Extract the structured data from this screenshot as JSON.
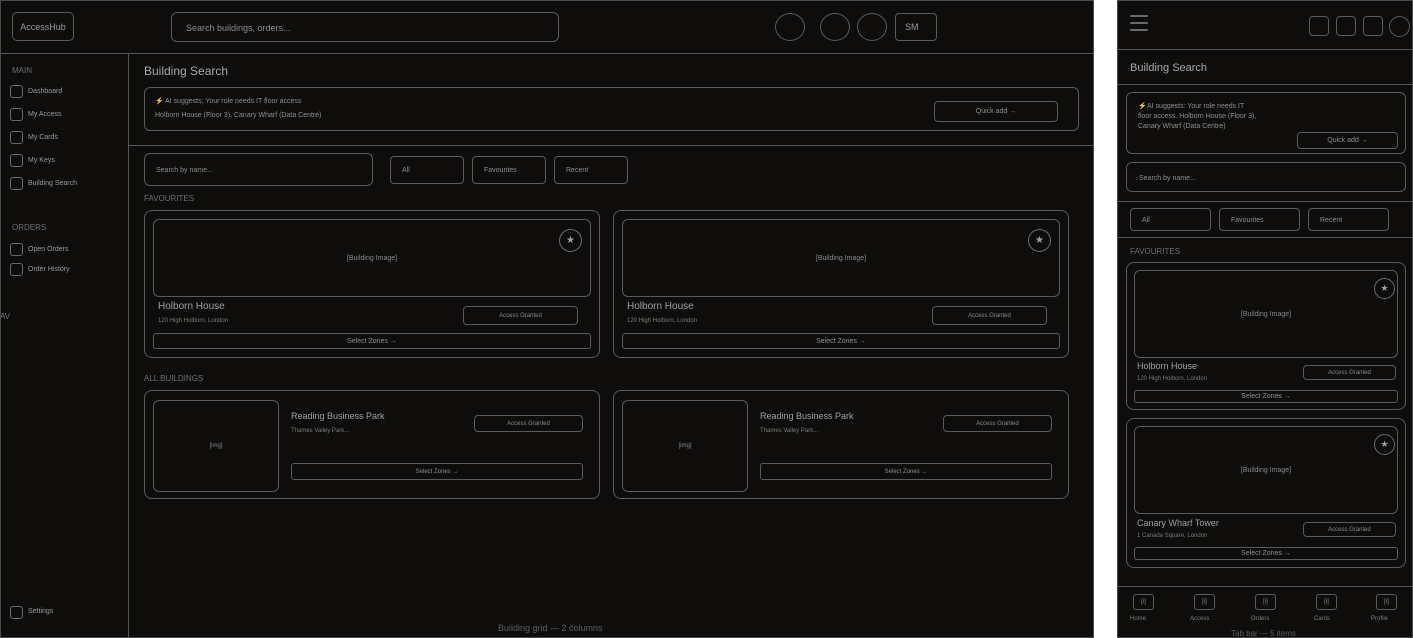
{
  "desktop": {
    "logo": "AccessHub",
    "search_placeholder": "Search buildings, orders...",
    "avatar_initials": "SM",
    "sidebar": {
      "main_header": "MAIN",
      "main_items": [
        "Dashboard",
        "My Access",
        "My Cards",
        "My Keys",
        "Building Search"
      ],
      "orders_header": "ORDERS",
      "orders_items": [
        "Open Orders",
        "Order History"
      ],
      "nav_fragment": "AV",
      "settings": "Settings"
    },
    "page_title": "Building Search",
    "ai": {
      "icon": "⚡",
      "line1": "AI suggests: Your role needs IT floor access",
      "line2": "Holborn House (Floor 3), Canary Wharf (Data Centre)",
      "quick_add": "Quick add →"
    },
    "filter": {
      "search_placeholder": "Search by name...",
      "chips": [
        "All",
        "Favourites",
        "Recent"
      ]
    },
    "favourites_header": "FAVOURITES",
    "favourites": [
      {
        "image": "[Building Image]",
        "star": "★",
        "name": "Holborn House",
        "address": "120 High Holborn, London",
        "status": "Access Granted",
        "action": "Select Zones →"
      },
      {
        "image": "[Building Image]",
        "star": "★",
        "name": "Holborn House",
        "address": "120 High Holborn, London",
        "status": "Access Granted",
        "action": "Select Zones →"
      }
    ],
    "all_header": "ALL BUILDINGS",
    "all_buildings": [
      {
        "image": "[img]",
        "name": "Reading Business Park",
        "address": "Thames Valley Park...",
        "status": "Access Granted",
        "action": "Select Zones →"
      },
      {
        "image": "[img]",
        "name": "Reading Business Park",
        "address": "Thames Valley Park...",
        "status": "Access Granted",
        "action": "Select Zones →"
      }
    ],
    "footer_note": "Building grid — 2 columns"
  },
  "mobile": {
    "page_title": "Building Search",
    "ai": {
      "icon": "⚡",
      "line1": "AI suggests: Your role needs IT",
      "line2": "floor access. Holborn House (Floor 3),",
      "line3": "Canary Wharf (Data Centre)",
      "quick_add": "Quick add →"
    },
    "search_placeholder": "Search by name...",
    "chips": [
      "All",
      "Favourites",
      "Recent"
    ],
    "favourites_header": "FAVOURITES",
    "favourites": [
      {
        "image": "[Building Image]",
        "star": "★",
        "name": "Holborn House",
        "address": "120 High Holborn, London",
        "status": "Access Granted",
        "action": "Select Zones →"
      },
      {
        "image": "[Building Image]",
        "star": "★",
        "name": "Canary Wharf Tower",
        "address": "1 Canada Square, London",
        "status": "Access Granted",
        "action": "Select Zones →"
      }
    ],
    "tabs": [
      {
        "icon": "[i]",
        "label": "Home"
      },
      {
        "icon": "[i]",
        "label": "Access"
      },
      {
        "icon": "[i]",
        "label": "Orders"
      },
      {
        "icon": "[i]",
        "label": "Cards"
      },
      {
        "icon": "[i]",
        "label": "Profile"
      }
    ],
    "tabbar_note": "Tab bar — 5 items"
  }
}
